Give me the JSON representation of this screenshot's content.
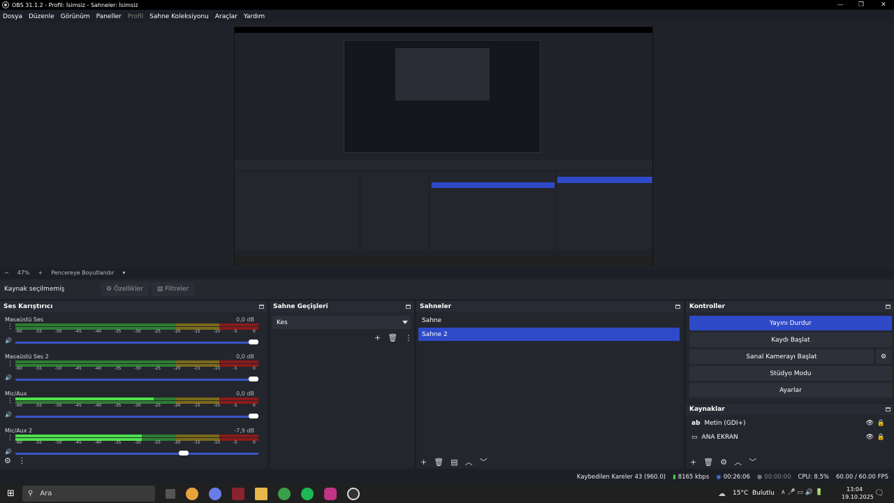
{
  "window": {
    "title": "OBS 31.1.2 - Profil: İsimsiz - Sahneler: İsimsiz"
  },
  "menu": [
    "Dosya",
    "Düzenle",
    "Görünüm",
    "Paneller",
    "Profil",
    "Sahne Koleksiyonu",
    "Araçlar",
    "Yardım"
  ],
  "zoom": {
    "level": "47%",
    "resize_label": "Pencereye Boyutlandır"
  },
  "context": {
    "no_source": "Kaynak seçilmemiş",
    "properties": "Özellikler",
    "filters": "Filtreler"
  },
  "mixer": {
    "title": "Ses Karıştırıcı",
    "channels": [
      {
        "name": "Masaüstü Ses",
        "db": "0,0 dB",
        "volume": 1.0
      },
      {
        "name": "Masaüstü Ses 2",
        "db": "0,0 dB",
        "volume": 1.0
      },
      {
        "name": "Mic/Aux",
        "db": "0,0 dB",
        "volume": 1.0
      },
      {
        "name": "Mic/Aux 2",
        "db": "-7,9 dB",
        "volume": 0.72
      }
    ],
    "ticks": [
      "-60",
      "-55",
      "-50",
      "-45",
      "-40",
      "-35",
      "-30",
      "-25",
      "-20",
      "-15",
      "-10",
      "-5",
      "0"
    ]
  },
  "transitions": {
    "title": "Sahne Geçişleri",
    "selected": "Kes"
  },
  "scenes": {
    "title": "Sahneler",
    "items": [
      "Sahne",
      "Sahne 2"
    ],
    "selected_index": 1
  },
  "controls": {
    "title": "Kontroller",
    "stop_stream": "Yayını Durdur",
    "start_record": "Kaydı Başlat",
    "start_virtualcam": "Sanal Kamerayı Başlat",
    "studio_mode": "Stüdyo Modu",
    "settings": "Ayarlar"
  },
  "sources": {
    "title": "Kaynaklar",
    "items": [
      "Metin (GDI+)",
      "ANA EKRAN"
    ]
  },
  "status": {
    "dropped": "Kaybedilen Kareler 43 (960.0)",
    "bitrate": "8165 kbps",
    "stream_time": "00:26:06",
    "rec_time": "00:00:00",
    "cpu": "CPU: 8.5%",
    "fps": "60.00 / 60.00 FPS"
  },
  "taskbar": {
    "search": "Ara",
    "weather": "15°C  Bulutlu",
    "time": "13:04",
    "date": "19.10.2025"
  },
  "colors": {
    "accent": "#2e4ac9",
    "meter_green": "#2e7d32",
    "meter_yellow": "#7a6a1a",
    "meter_red": "#8b1a1a"
  }
}
